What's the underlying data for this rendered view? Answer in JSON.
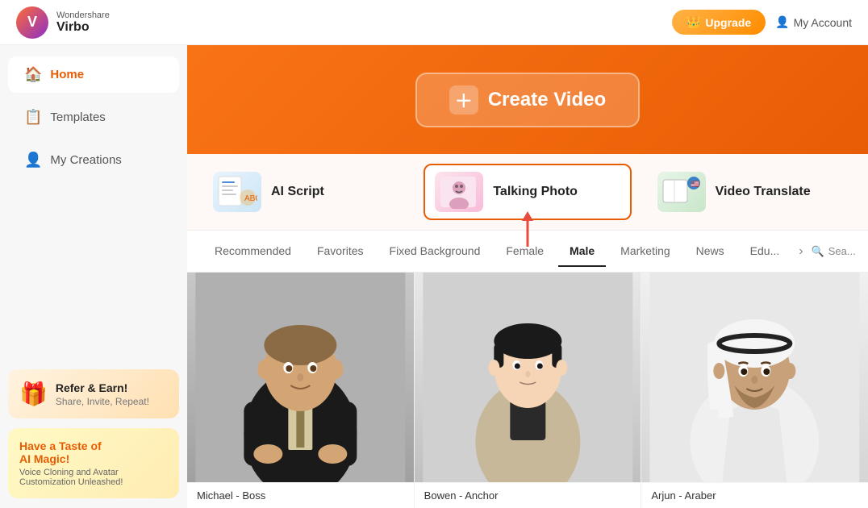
{
  "topbar": {
    "brand": "Wondershare",
    "product": "Virbo",
    "upgrade_label": "Upgrade",
    "account_label": "My Account"
  },
  "sidebar": {
    "items": [
      {
        "id": "home",
        "label": "Home",
        "icon": "🏠",
        "active": true
      },
      {
        "id": "templates",
        "label": "Templates",
        "icon": "📋",
        "active": false
      },
      {
        "id": "my-creations",
        "label": "My Creations",
        "icon": "👤",
        "active": false
      }
    ],
    "refer_banner": {
      "title": "Refer & Earn!",
      "subtitle": "Share, Invite, Repeat!"
    },
    "ai_banner": {
      "prefix": "Have a Taste of",
      "highlight": "AI Magic!",
      "subtitle": "Voice Cloning and Avatar Customization Unleashed!"
    }
  },
  "hero": {
    "create_video_label": "Create Video"
  },
  "features": [
    {
      "id": "ai-script",
      "label": "AI Script",
      "icon": "📄",
      "active": false
    },
    {
      "id": "talking-photo",
      "label": "Talking Photo",
      "icon": "🖼️",
      "active": true
    },
    {
      "id": "video-translate",
      "label": "Video Translate",
      "icon": "🌐",
      "active": false
    }
  ],
  "tabs": [
    {
      "id": "recommended",
      "label": "Recommended",
      "active": false
    },
    {
      "id": "favorites",
      "label": "Favorites",
      "active": false
    },
    {
      "id": "fixed-background",
      "label": "Fixed Background",
      "active": false
    },
    {
      "id": "female",
      "label": "Female",
      "active": false
    },
    {
      "id": "male",
      "label": "Male",
      "active": true
    },
    {
      "id": "marketing",
      "label": "Marketing",
      "active": false
    },
    {
      "id": "news",
      "label": "News",
      "active": false
    },
    {
      "id": "education",
      "label": "Edu...",
      "active": false
    }
  ],
  "tabs_search_label": "Sea...",
  "avatars": [
    {
      "id": "michael",
      "name": "Michael - Boss",
      "bg": "michael"
    },
    {
      "id": "bowen",
      "name": "Bowen - Anchor",
      "bg": "bowen"
    },
    {
      "id": "arjun",
      "name": "Arjun - Araber",
      "bg": "arjun"
    }
  ]
}
